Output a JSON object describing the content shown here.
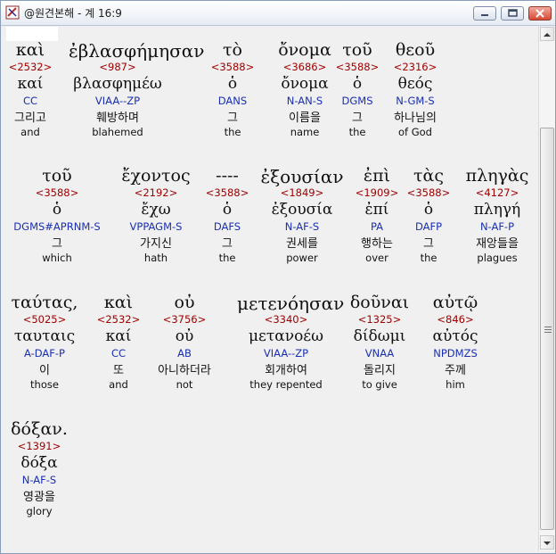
{
  "window": {
    "title": "@원견본해 - 계 16:9"
  },
  "rows": [
    [
      {
        "greek": "καὶ",
        "strong": "<2532>",
        "lemma": "καί",
        "morph": "CC",
        "korean": "그리고",
        "english": "and"
      },
      {
        "greek": "ἐβλασφήμησαν",
        "strong": "<987>",
        "lemma": "βλασφημέω",
        "morph": "VIAA--ZP",
        "korean": "훼방하며",
        "english": "blahemed"
      },
      {
        "greek": "τὸ",
        "strong": "<3588>",
        "lemma": "ὁ",
        "morph": "DANS",
        "korean": "그",
        "english": "the"
      },
      {
        "greek": "ὄνομα",
        "strong": "<3686>",
        "lemma": "ὄνομα",
        "morph": "N-AN-S",
        "korean": "이름을",
        "english": "name"
      },
      {
        "greek": "τοῦ",
        "strong": "<3588>",
        "lemma": "ὁ",
        "morph": "DGMS",
        "korean": "그",
        "english": "the"
      },
      {
        "greek": "θεοῦ",
        "strong": "<2316>",
        "lemma": "θεός",
        "morph": "N-GM-S",
        "korean": "하나님의",
        "english": "of God"
      }
    ],
    [
      {
        "greek": "τοῦ",
        "strong": "<3588>",
        "lemma": "ὁ",
        "morph": "DGMS#APRNM-S",
        "korean": "그",
        "english": "which"
      },
      {
        "greek": "ἔχοντος",
        "strong": "<2192>",
        "lemma": "ἔχω",
        "morph": "VPPAGM-S",
        "korean": "가지신",
        "english": "hath"
      },
      {
        "greek": "----",
        "strong": "<3588>",
        "lemma": "ὁ",
        "morph": "DAFS",
        "korean": "그",
        "english": "the"
      },
      {
        "greek": "ἐξουσίαν",
        "strong": "<1849>",
        "lemma": "ἐξουσία",
        "morph": "N-AF-S",
        "korean": "권세를",
        "english": "power"
      },
      {
        "greek": "ἐπὶ",
        "strong": "<1909>",
        "lemma": "ἐπί",
        "morph": "PA",
        "korean": "행하는",
        "english": "over"
      },
      {
        "greek": "τὰς",
        "strong": "<3588>",
        "lemma": "ὁ",
        "morph": "DAFP",
        "korean": "그",
        "english": "the"
      },
      {
        "greek": "πληγὰς",
        "strong": "<4127>",
        "lemma": "πληγή",
        "morph": "N-AF-P",
        "korean": "재앙들을",
        "english": "plagues"
      }
    ],
    [
      {
        "greek": "ταύτας,",
        "strong": "<5025>",
        "lemma": "ταυταις",
        "morph": "A-DAF-P",
        "korean": "이",
        "english": "those"
      },
      {
        "greek": "καὶ",
        "strong": "<2532>",
        "lemma": "καί",
        "morph": "CC",
        "korean": "또",
        "english": "and"
      },
      {
        "greek": "οὐ",
        "strong": "<3756>",
        "lemma": "οὐ",
        "morph": "AB",
        "korean": "아니하더라",
        "english": "not"
      },
      {
        "greek": "μετενόησαν",
        "strong": "<3340>",
        "lemma": "μετανοέω",
        "morph": "VIAA--ZP",
        "korean": "회개하여",
        "english": "they repented"
      },
      {
        "greek": "δοῦναι",
        "strong": "<1325>",
        "lemma": "δίδωμι",
        "morph": "VNAA",
        "korean": "돌리지",
        "english": "to give"
      },
      {
        "greek": "αὐτῷ",
        "strong": "<846>",
        "lemma": "αὐτός",
        "morph": "NPDMZS",
        "korean": "주께",
        "english": "him"
      }
    ],
    [
      {
        "greek": "δόξαν.",
        "strong": "<1391>",
        "lemma": "δόξα",
        "morph": "N-AF-S",
        "korean": "영광을",
        "english": "glory"
      }
    ]
  ],
  "colors": {
    "strong": "#a00000",
    "morph": "#1a2fb0",
    "text": "#111111"
  },
  "icons": [
    "app-icon",
    "minimize-icon",
    "maximize-icon",
    "close-icon",
    "scroll-up-arrow-icon",
    "scroll-down-arrow-icon",
    "scroll-grip-icon"
  ]
}
